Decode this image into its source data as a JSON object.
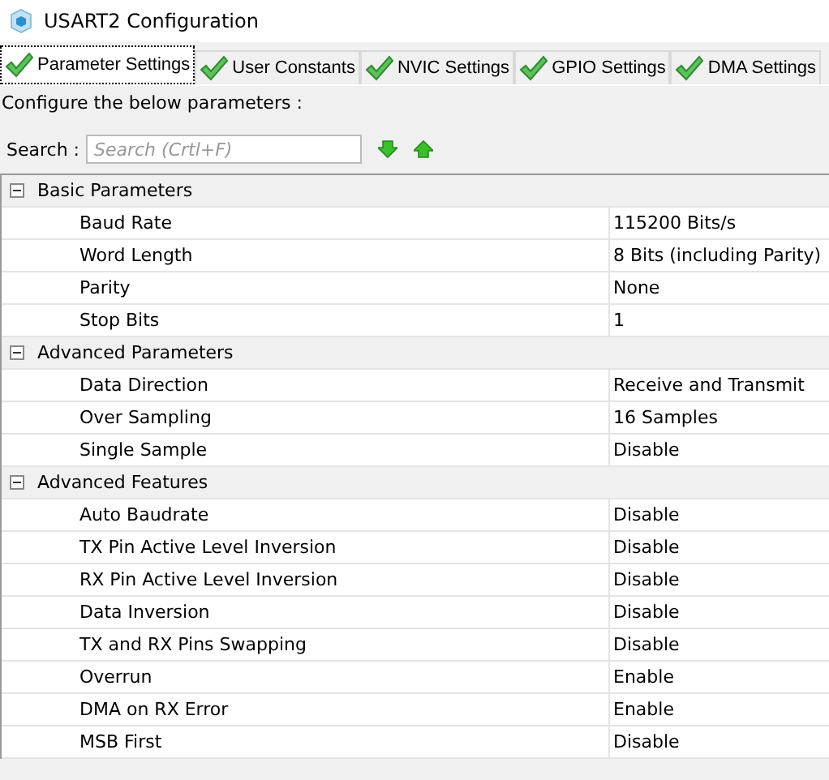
{
  "window": {
    "title": "USART2 Configuration"
  },
  "tabs": [
    {
      "label": "Parameter Settings",
      "selected": true
    },
    {
      "label": "User Constants",
      "selected": false
    },
    {
      "label": "NVIC Settings",
      "selected": false
    },
    {
      "label": "GPIO Settings",
      "selected": false
    },
    {
      "label": "DMA Settings",
      "selected": false
    }
  ],
  "instruction": "Configure the below parameters :",
  "search": {
    "label": "Search :",
    "placeholder": "Search (Crtl+F)"
  },
  "groups": [
    {
      "name": "Basic Parameters",
      "expanded": true,
      "rows": [
        {
          "name": "Baud Rate",
          "value": "115200 Bits/s"
        },
        {
          "name": "Word Length",
          "value": "8 Bits (including Parity)"
        },
        {
          "name": "Parity",
          "value": "None"
        },
        {
          "name": "Stop Bits",
          "value": "1"
        }
      ]
    },
    {
      "name": "Advanced Parameters",
      "expanded": true,
      "rows": [
        {
          "name": "Data Direction",
          "value": "Receive and Transmit"
        },
        {
          "name": "Over Sampling",
          "value": "16 Samples"
        },
        {
          "name": "Single Sample",
          "value": "Disable"
        }
      ]
    },
    {
      "name": "Advanced Features",
      "expanded": true,
      "rows": [
        {
          "name": "Auto Baudrate",
          "value": "Disable"
        },
        {
          "name": "TX Pin Active Level Inversion",
          "value": "Disable"
        },
        {
          "name": "RX Pin Active Level Inversion",
          "value": "Disable"
        },
        {
          "name": "Data Inversion",
          "value": "Disable"
        },
        {
          "name": "TX and RX Pins Swapping",
          "value": "Disable"
        },
        {
          "name": "Overrun",
          "value": "Enable"
        },
        {
          "name": "DMA on RX Error",
          "value": "Enable"
        },
        {
          "name": "MSB First",
          "value": "Disable"
        }
      ]
    }
  ]
}
